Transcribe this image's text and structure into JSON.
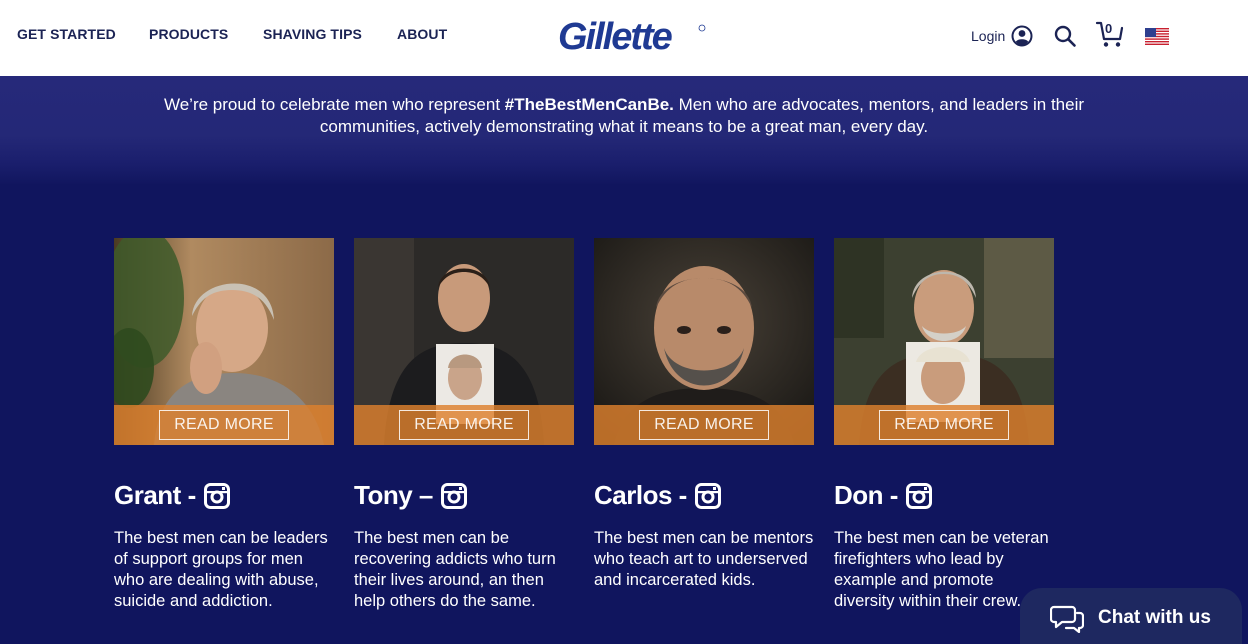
{
  "nav": {
    "items": [
      {
        "label": "GET STARTED"
      },
      {
        "label": "PRODUCTS"
      },
      {
        "label": "SHAVING TIPS"
      },
      {
        "label": "ABOUT"
      }
    ],
    "logo_text": "Gillette",
    "login_label": "Login",
    "cart_count": "0",
    "icons": [
      "user-circle-icon",
      "search-icon",
      "cart-icon",
      "us-flag-icon"
    ]
  },
  "intro": {
    "lead": "We’re proud to celebrate men who represent ",
    "hashtag": "#TheBestMenCanBe.",
    "rest": " Men who are advocates, mentors, and leaders in their communities, actively demonstrating what it means to be a great man, every day."
  },
  "colors": {
    "header_bg": "#ffffff",
    "nav_text": "#1b2354",
    "logo": "#1f3a93",
    "page_bg": "#10155e",
    "accent_orange": "#dd802d",
    "chat_bg": "#1e2860"
  },
  "cards": [
    {
      "name": "Grant -",
      "read_more": "READ MORE",
      "icon": "instagram-icon",
      "desc": "The best men can be leaders of support groups for men who are dealing with abuse, suicide and addiction."
    },
    {
      "name": "Tony –",
      "read_more": "READ MORE",
      "icon": "instagram-icon",
      "desc": "The best men can be recovering addicts who turn their lives around, an then help others do the same."
    },
    {
      "name": "Carlos -",
      "read_more": "READ MORE",
      "icon": "instagram-icon",
      "desc": "The best men can be mentors who teach art to underserved and incarcerated kids."
    },
    {
      "name": "Don -",
      "read_more": "READ MORE",
      "icon": "instagram-icon",
      "desc": "The best men can be veteran firefighters who lead by example and promote diversity within their crew."
    }
  ],
  "chat": {
    "label": "Chat with us",
    "icon": "chat-bubbles-icon"
  }
}
